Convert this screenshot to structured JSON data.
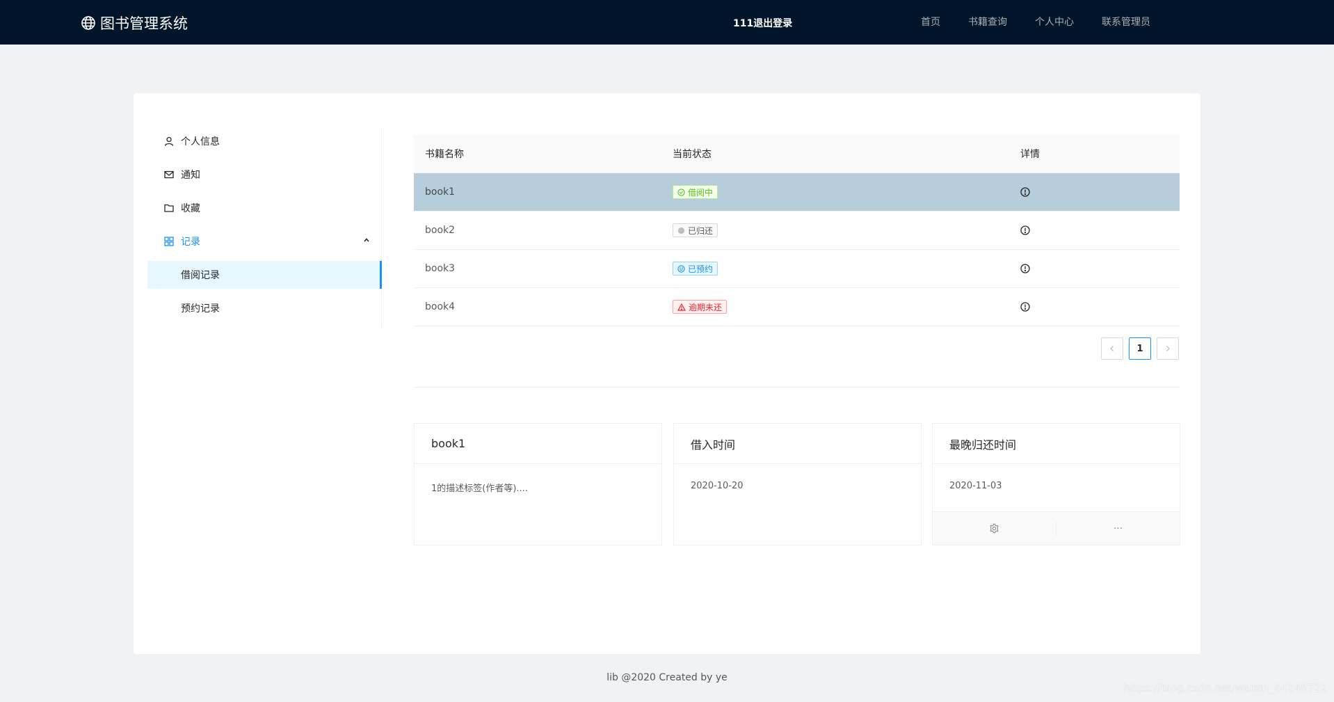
{
  "header": {
    "logo_text": "图书管理系统",
    "user_text": "111退出登录",
    "nav": [
      "首页",
      "书籍查询",
      "个人中心",
      "联系管理员"
    ]
  },
  "sidebar": {
    "items": [
      {
        "label": "个人信息",
        "icon": "user-icon"
      },
      {
        "label": "通知",
        "icon": "mail-icon"
      },
      {
        "label": "收藏",
        "icon": "folder-icon"
      },
      {
        "label": "记录",
        "icon": "appstore-icon"
      }
    ],
    "sub_items": [
      {
        "label": "借阅记录"
      },
      {
        "label": "预约记录"
      }
    ]
  },
  "table": {
    "columns": [
      "书籍名称",
      "当前状态",
      "详情"
    ],
    "rows": [
      {
        "name": "book1",
        "status": "借阅中"
      },
      {
        "name": "book2",
        "status": "已归还"
      },
      {
        "name": "book3",
        "status": "已预约"
      },
      {
        "name": "book4",
        "status": "逾期未还"
      }
    ]
  },
  "pagination": {
    "current": "1"
  },
  "detail": {
    "book_title": "book1",
    "book_desc": "1的描述标签(作者等)....",
    "borrow_label": "借入时间",
    "borrow_date": "2020-10-20",
    "due_label": "最晚归还时间",
    "due_date": "2020-11-03",
    "more": "···"
  },
  "footer": "lib @2020 Created by ye",
  "watermark": "https://blog.csdn.net/weixin_44248722",
  "colors": {
    "header_bg": "#001529",
    "accent": "#1890ff",
    "selected_row": "#b7cddb"
  }
}
